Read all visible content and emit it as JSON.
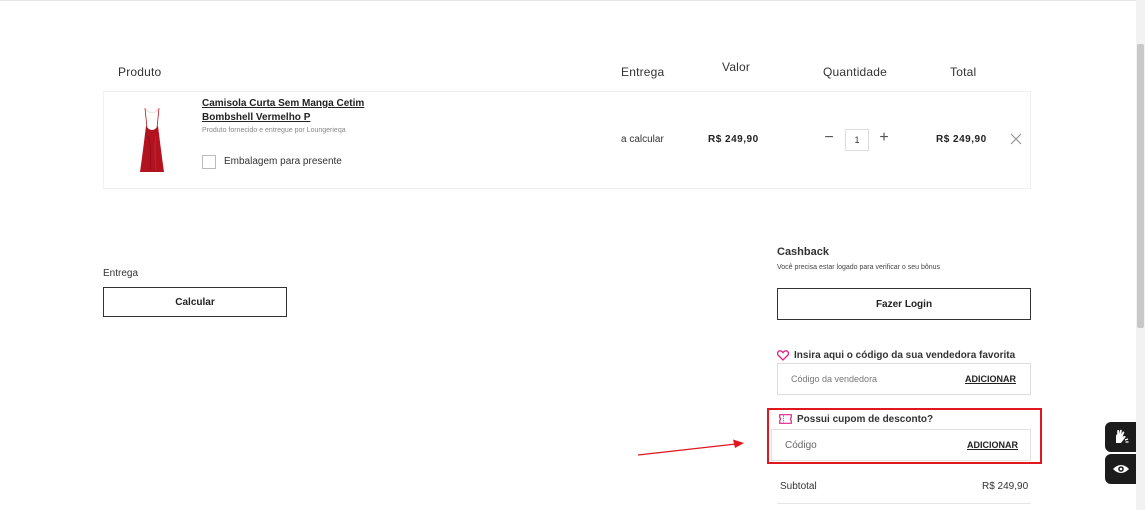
{
  "table": {
    "headers": {
      "produto": "Produto",
      "entrega": "Entrega",
      "valor": "Valor",
      "quantidade": "Quantidade",
      "total": "Total"
    }
  },
  "cart": {
    "items": [
      {
        "name_line1": "Camisola Curta Sem Manga Cetim",
        "name_line2": "Bombshell Vermelho P",
        "seller": "Produto fornecido e entregue por Loungerieqa",
        "gift_label": "Embalagem para presente",
        "gift_checked": false,
        "entrega": "a calcular",
        "valor": "R$ 249,90",
        "quantity": "1",
        "minus_symbol": "−",
        "plus_symbol": "+",
        "total": "R$ 249,90",
        "remove_icon": "close-icon",
        "image_color": "#b3131f"
      }
    ]
  },
  "shipping": {
    "label": "Entrega",
    "button": "Calcular"
  },
  "cashback": {
    "title": "Cashback",
    "note": "Você precisa estar logado para verificar o seu bônus",
    "button": "Fazer Login"
  },
  "seller_code": {
    "icon": "heart-icon",
    "icon_color": "#e0218a",
    "title": "Insira aqui o código da sua vendedora favorita",
    "placeholder": "Código da vendedora",
    "button": "ADICIONAR"
  },
  "coupon": {
    "icon": "ticket-icon",
    "icon_color": "#e0218a",
    "title": "Possui cupom de desconto?",
    "placeholder": "Código",
    "button": "ADICIONAR",
    "highlight_color": "#e0171f"
  },
  "summary": {
    "subtotal_label": "Subtotal",
    "subtotal_value": "R$ 249,90"
  },
  "accessibility": {
    "libras_icon": "sign-language-icon",
    "eye_icon": "eye-icon"
  }
}
